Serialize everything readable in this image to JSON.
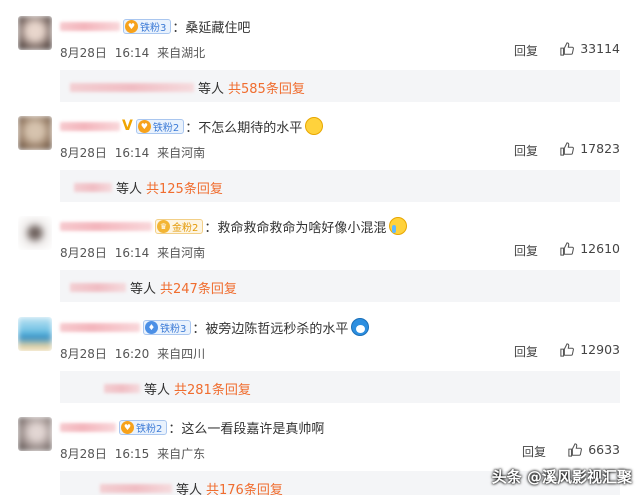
{
  "comments": [
    {
      "fan_label": "铁粉3",
      "fan_style": "blue",
      "text": "桑延藏住吧",
      "emoji": "",
      "date": "8月28日",
      "time": "16:14",
      "location": "来自湖北",
      "reply_label": "回复",
      "likes": "33114",
      "sub_deng": "等人",
      "sub_total": "共585条回复"
    },
    {
      "fan_label": "铁粉2",
      "fan_style": "blue",
      "text": "不怎么期待的水平",
      "emoji": "smile-emoji",
      "date": "8月28日",
      "time": "16:14",
      "location": "来自河南",
      "reply_label": "回复",
      "likes": "17823",
      "sub_deng": "等人",
      "sub_total": "共125条回复"
    },
    {
      "fan_label": "金粉2",
      "fan_style": "gold",
      "text": "救命救命救命为啥好像小混混",
      "emoji": "cry-emoji",
      "date": "8月28日",
      "time": "16:14",
      "location": "来自河南",
      "reply_label": "回复",
      "likes": "12610",
      "sub_deng": "等人",
      "sub_total": "共247条回复"
    },
    {
      "fan_label": "铁粉3",
      "fan_style": "blue",
      "text": "被旁边陈哲远秒杀的水平",
      "emoji": "doraemon-emoji",
      "date": "8月28日",
      "time": "16:20",
      "location": "来自四川",
      "reply_label": "回复",
      "likes": "12903",
      "sub_deng": "等人",
      "sub_total": "共281条回复"
    },
    {
      "fan_label": "铁粉2",
      "fan_style": "blue",
      "text": "这么一看段嘉许是真帅啊",
      "emoji": "",
      "date": "8月28日",
      "time": "16:15",
      "location": "来自广东",
      "reply_label": "回复",
      "likes": "6633",
      "sub_deng": "等人",
      "sub_total": "共176条回复"
    }
  ],
  "watermark": "头条 @溪风影视汇聚",
  "colors": {
    "accent": "#f06d2f",
    "fan_badge_blue": "#3d7bd6",
    "fan_badge_gold": "#e39a09"
  }
}
